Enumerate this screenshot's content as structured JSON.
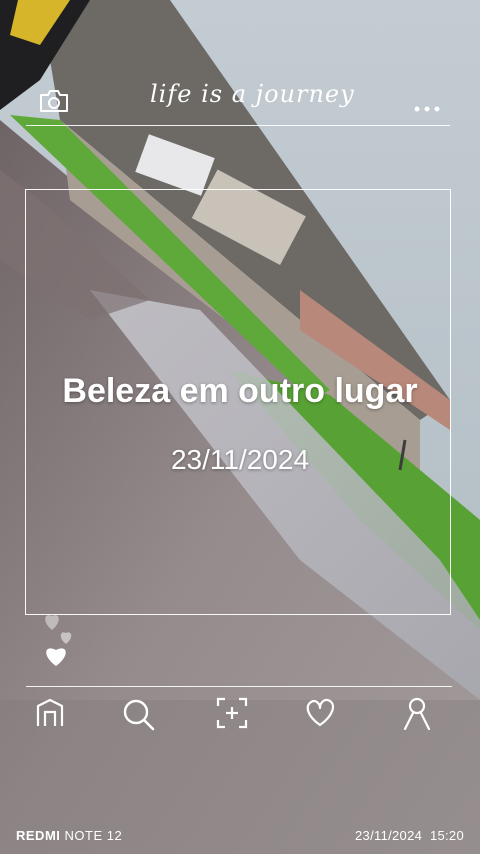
{
  "header": {
    "camera_icon": "camera-icon",
    "tagline": "life is a journey",
    "more_icon": "more-dots-icon"
  },
  "card": {
    "title": "Beleza em outro lugar",
    "date": "23/11/2024"
  },
  "hearts_icon": "hearts-icon",
  "nav": {
    "items": [
      {
        "icon": "home-icon"
      },
      {
        "icon": "search-icon"
      },
      {
        "icon": "add-photo-icon"
      },
      {
        "icon": "heart-icon"
      },
      {
        "icon": "profile-icon"
      }
    ]
  },
  "watermark": {
    "brand": "REDMI",
    "model": "NOTE 12",
    "timestamp": "23/11/2024  15:20"
  },
  "colors": {
    "grass": "#5fa83a",
    "sky": "#b9c4cc",
    "pavement": "#8e8688"
  }
}
